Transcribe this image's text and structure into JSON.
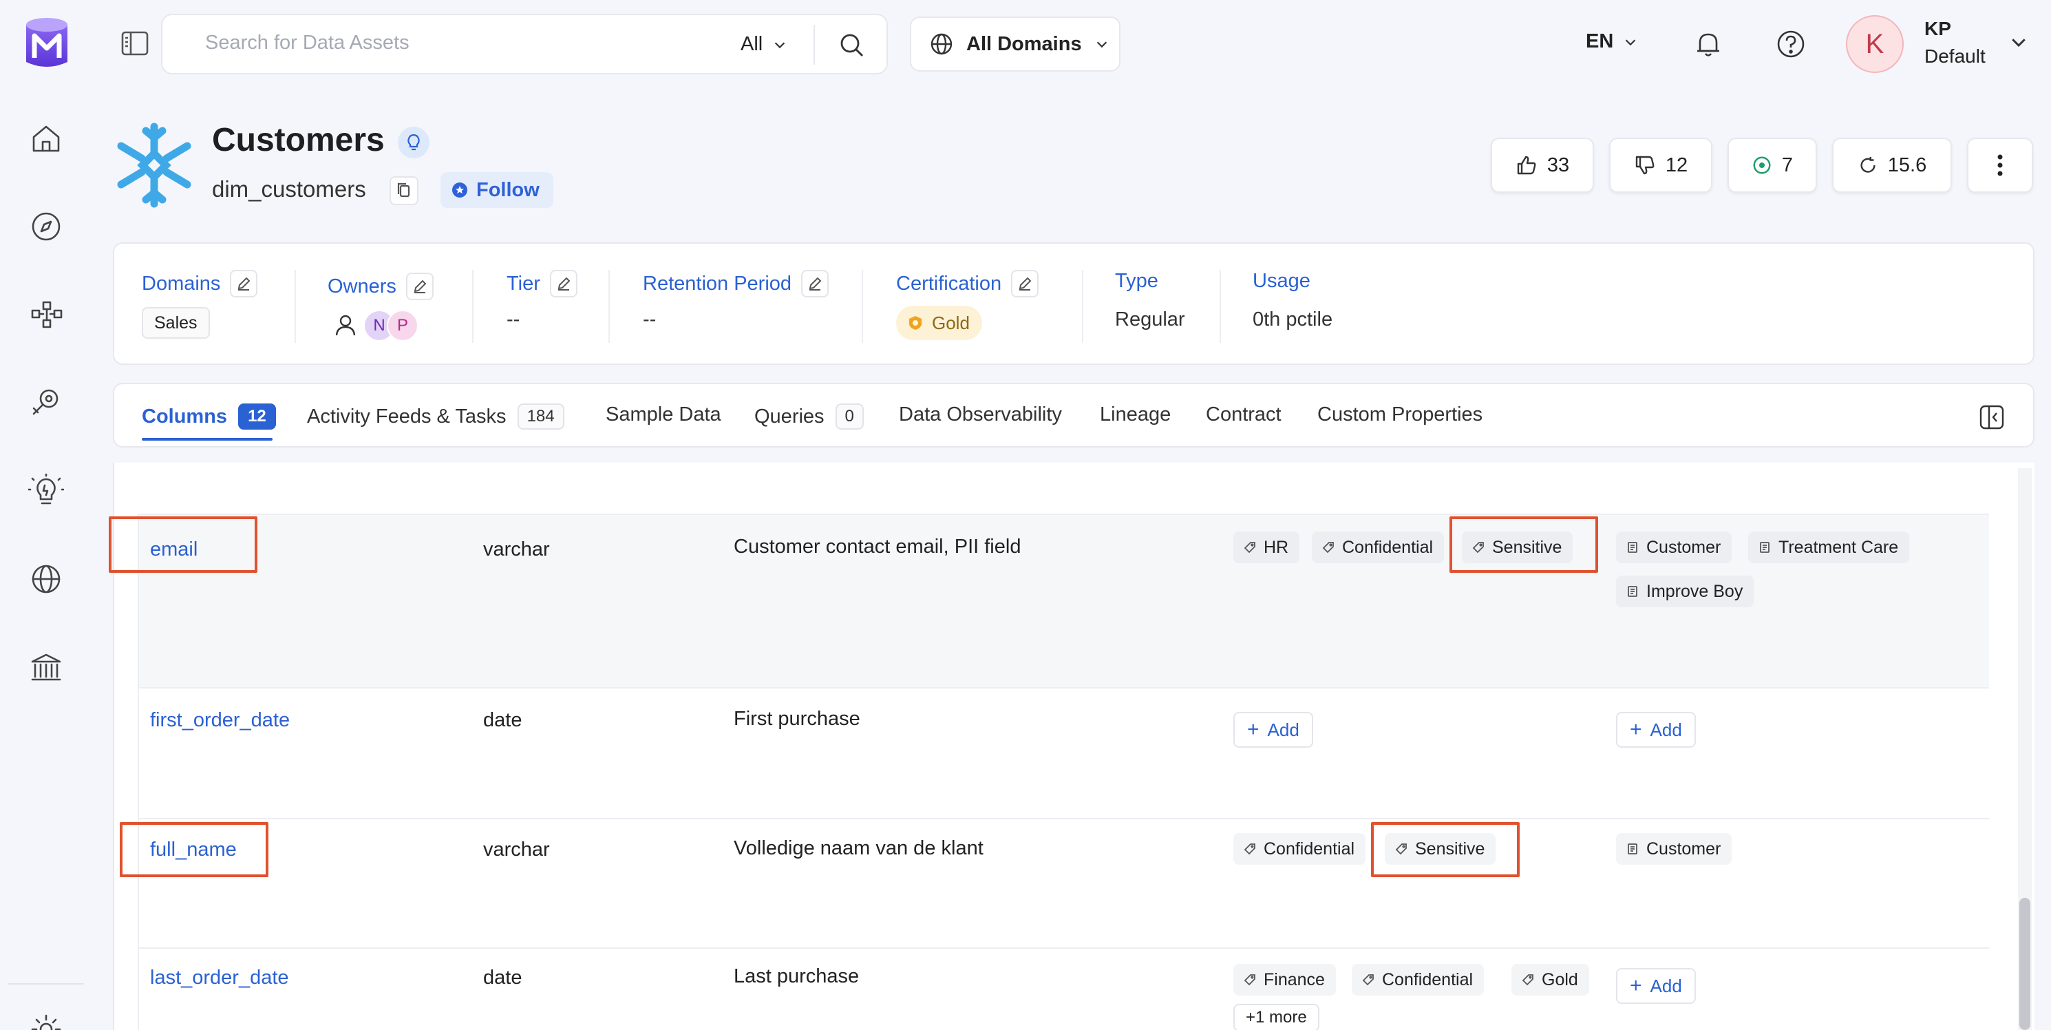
{
  "header": {
    "search_placeholder": "Search for Data Assets",
    "search_scope": "All",
    "domain_selector": "All Domains",
    "language": "EN",
    "user": {
      "initial": "K",
      "name": "KP",
      "role": "Default"
    }
  },
  "sidebar": {
    "icons": [
      "home-icon",
      "explore-icon",
      "lineage-icon",
      "observability-icon",
      "insights-icon",
      "domains-icon",
      "governance-icon",
      "settings-icon"
    ]
  },
  "entity": {
    "title": "Customers",
    "fqn": "dim_customers",
    "follow_label": "Follow",
    "metrics": {
      "likes": "33",
      "dislikes": "12",
      "tests": "7",
      "version": "15.6"
    }
  },
  "info": {
    "domains": {
      "label": "Domains",
      "value": "Sales"
    },
    "owners": {
      "label": "Owners",
      "avatars": [
        "N",
        "P"
      ]
    },
    "tier": {
      "label": "Tier",
      "value": "--"
    },
    "retention": {
      "label": "Retention Period",
      "value": "--"
    },
    "certification": {
      "label": "Certification",
      "value": "Gold"
    },
    "type": {
      "label": "Type",
      "value": "Regular"
    },
    "usage": {
      "label": "Usage",
      "value": "0th pctile"
    }
  },
  "tabs": [
    {
      "label": "Columns",
      "count": "12"
    },
    {
      "label": "Activity Feeds & Tasks",
      "count": "184"
    },
    {
      "label": "Sample Data"
    },
    {
      "label": "Queries",
      "count": "0"
    },
    {
      "label": "Data Observability"
    },
    {
      "label": "Lineage"
    },
    {
      "label": "Contract"
    },
    {
      "label": "Custom Properties"
    }
  ],
  "rows": [
    {
      "name": "email",
      "type": "varchar",
      "description": "Customer contact email, PII field",
      "tags": [
        "HR",
        "Confidential",
        "Sensitive"
      ],
      "glossary": [
        "Customer",
        "Treatment Care",
        "Improve Boy"
      ]
    },
    {
      "name": "first_order_date",
      "type": "date",
      "description": "First purchase",
      "tags_add": "Add",
      "glossary_add": "Add"
    },
    {
      "name": "full_name",
      "type": "varchar",
      "description": "Volledige naam van de klant",
      "tags": [
        "Confidential",
        "Sensitive"
      ],
      "glossary": [
        "Customer"
      ]
    },
    {
      "name": "last_order_date",
      "type": "date",
      "description": "Last purchase",
      "tags": [
        "Finance",
        "Confidential",
        "Gold"
      ],
      "tags_more": "+1 more",
      "glossary_add": "Add"
    }
  ],
  "colors": {
    "accent": "#2a61d3",
    "highlight": "#e0522f",
    "brand": "#7147e8"
  }
}
